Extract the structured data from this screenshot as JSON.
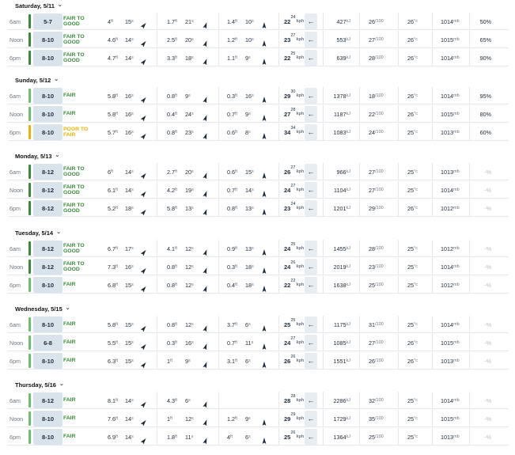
{
  "units": {
    "ft": "ft",
    "s": "s",
    "kph": "kph",
    "kj": "kJ",
    "score": "/100",
    "deg": "°",
    "c": "c",
    "mb": "mb",
    "pct": "%"
  },
  "colors": {
    "good": "#3a8a3a",
    "fair": "#6cc06c",
    "poor": "#e8b400",
    "size_bg": "#d9e3ec"
  },
  "days": [
    {
      "title": "Saturday, 5/11",
      "rows": [
        {
          "time": "6am",
          "size": "5-7",
          "rating": "FAIR TO GOOD",
          "rtype": "good",
          "s1h": "4",
          "s1p": "15",
          "s2h": "1.7",
          "s2p": "21",
          "s3h": "1.4",
          "s3p": "10",
          "wind": "22",
          "gust": "24",
          "kj": "427",
          "wt": "26",
          "temp": "26",
          "pres": "1014",
          "precip": "50"
        },
        {
          "time": "Noon",
          "size": "8-10",
          "rating": "FAIR TO GOOD",
          "rtype": "good",
          "s1h": "4.6",
          "s1p": "14",
          "s2h": "2.5",
          "s2p": "20",
          "s3h": "1.2",
          "s3p": "10",
          "wind": "23",
          "gust": "27",
          "kj": "553",
          "wt": "27",
          "temp": "26",
          "pres": "1015",
          "precip": "65"
        },
        {
          "time": "6pm",
          "size": "8-10",
          "rating": "FAIR TO GOOD",
          "rtype": "good",
          "s1h": "4.7",
          "s1p": "14",
          "s2h": "3.3",
          "s2p": "18",
          "s3h": "1.1",
          "s3p": "9",
          "wind": "22",
          "gust": "25",
          "kj": "639",
          "wt": "28",
          "temp": "26",
          "pres": "1014",
          "precip": "90"
        }
      ]
    },
    {
      "title": "Sunday, 5/12",
      "rows": [
        {
          "time": "6am",
          "size": "8-10",
          "rating": "FAIR",
          "rtype": "fair",
          "s1h": "5.8",
          "s1p": "16",
          "s2h": "0.8",
          "s2p": "9",
          "s3h": "0.3",
          "s3p": "16",
          "wind": "29",
          "gust": "30",
          "kj": "1378",
          "wt": "18",
          "temp": "26",
          "pres": "1014",
          "precip": "95"
        },
        {
          "time": "Noon",
          "size": "8-10",
          "rating": "FAIR",
          "rtype": "fair",
          "s1h": "5.8",
          "s1p": "16",
          "s2h": "0.4",
          "s2p": "24",
          "s3h": "0.7",
          "s3p": "9",
          "wind": "27",
          "gust": "28",
          "kj": "1187",
          "wt": "22",
          "temp": "26",
          "pres": "1015",
          "precip": "80"
        },
        {
          "time": "6pm",
          "size": "8-10",
          "rating": "POOR TO FAIR",
          "rtype": "poor",
          "s1h": "5.7",
          "s1p": "16",
          "s2h": "0.8",
          "s2p": "23",
          "s3h": "0.6",
          "s3p": "8",
          "wind": "34",
          "gust": "34",
          "kj": "1083",
          "wt": "24",
          "temp": "25",
          "pres": "1013",
          "precip": "60"
        }
      ]
    },
    {
      "title": "Monday, 5/13",
      "rows": [
        {
          "time": "6am",
          "size": "8-12",
          "rating": "FAIR TO GOOD",
          "rtype": "good",
          "s1h": "6",
          "s1p": "14",
          "s2h": "2.7",
          "s2p": "20",
          "s3h": "0.6",
          "s3p": "15",
          "wind": "26",
          "gust": "27",
          "kj": "966",
          "wt": "27",
          "temp": "25",
          "pres": "1013",
          "precip": "-"
        },
        {
          "time": "Noon",
          "size": "8-12",
          "rating": "FAIR TO GOOD",
          "rtype": "good",
          "s1h": "6.1",
          "s1p": "14",
          "s2h": "4.2",
          "s2p": "19",
          "s3h": "0.7",
          "s3p": "14",
          "wind": "24",
          "gust": "27",
          "kj": "1104",
          "wt": "27",
          "temp": "25",
          "pres": "1014",
          "precip": "-"
        },
        {
          "time": "6pm",
          "size": "8-12",
          "rating": "FAIR TO GOOD",
          "rtype": "good",
          "s1h": "5.2",
          "s1p": "18",
          "s2h": "5.8",
          "s2p": "13",
          "s3h": "0.8",
          "s3p": "13",
          "wind": "23",
          "gust": "24",
          "kj": "1201",
          "wt": "29",
          "temp": "26",
          "pres": "1012",
          "precip": "-"
        }
      ]
    },
    {
      "title": "Tuesday, 5/14",
      "rows": [
        {
          "time": "6am",
          "size": "8-12",
          "rating": "FAIR TO GOOD",
          "rtype": "good",
          "s1h": "6.7",
          "s1p": "17",
          "s2h": "4.1",
          "s2p": "12",
          "s3h": "0.9",
          "s3p": "13",
          "wind": "24",
          "gust": "25",
          "kj": "1455",
          "wt": "28",
          "temp": "25",
          "pres": "1012",
          "precip": "-"
        },
        {
          "time": "Noon",
          "size": "8-12",
          "rating": "FAIR TO GOOD",
          "rtype": "good",
          "s1h": "7.3",
          "s1p": "16",
          "s2h": "0.8",
          "s2p": "12",
          "s3h": "0.3",
          "s3p": "18",
          "wind": "24",
          "gust": "26",
          "kj": "2019",
          "wt": "23",
          "temp": "25",
          "pres": "1014",
          "precip": "-"
        },
        {
          "time": "6pm",
          "size": "8-10",
          "rating": "FAIR",
          "rtype": "fair",
          "s1h": "6.8",
          "s1p": "15",
          "s2h": "0.8",
          "s2p": "12",
          "s3h": "0.4",
          "s3p": "18",
          "wind": "22",
          "gust": "22",
          "kj": "1638",
          "wt": "25",
          "temp": "25",
          "pres": "1012",
          "precip": "-"
        }
      ]
    },
    {
      "title": "Wednesday, 5/15",
      "rows": [
        {
          "time": "6am",
          "size": "8-10",
          "rating": "FAIR",
          "rtype": "fair",
          "s1h": "5.8",
          "s1p": "15",
          "s2h": "0.8",
          "s2p": "12",
          "s3h": "3.7",
          "s3p": "6",
          "wind": "25",
          "gust": "25",
          "kj": "1175",
          "wt": "31",
          "temp": "25",
          "pres": "1014",
          "precip": "-"
        },
        {
          "time": "Noon",
          "size": "6-8",
          "rating": "FAIR",
          "rtype": "fair",
          "s1h": "5.5",
          "s1p": "15",
          "s2h": "0.3",
          "s2p": "16",
          "s3h": "0.7",
          "s3p": "11",
          "wind": "24",
          "gust": "27",
          "kj": "1085",
          "wt": "27",
          "temp": "26",
          "pres": "1015",
          "precip": "-"
        },
        {
          "time": "6pm",
          "size": "8-10",
          "rating": "FAIR",
          "rtype": "fair",
          "s1h": "6.3",
          "s1p": "15",
          "s2h": "1",
          "s2p": "9",
          "s3h": "3.1",
          "s3p": "6",
          "wind": "26",
          "gust": "26",
          "kj": "1551",
          "wt": "26",
          "temp": "26",
          "pres": "1013",
          "precip": "-"
        }
      ]
    },
    {
      "title": "Thursday, 5/16",
      "rows": [
        {
          "time": "6am",
          "size": "8-12",
          "rating": "FAIR",
          "rtype": "fair",
          "s1h": "8.1",
          "s1p": "14",
          "s2h": "4.3",
          "s2p": "6",
          "s3h": "",
          "s3p": "",
          "wind": "28",
          "gust": "28",
          "kj": "2286",
          "wt": "32",
          "temp": "25",
          "pres": "1014",
          "precip": "-"
        },
        {
          "time": "Noon",
          "size": "8-10",
          "rating": "FAIR",
          "rtype": "fair",
          "s1h": "7.6",
          "s1p": "14",
          "s2h": "1",
          "s2p": "12",
          "s3h": "1.2",
          "s3p": "9",
          "wind": "29",
          "gust": "29",
          "kj": "1729",
          "wt": "35",
          "temp": "25",
          "pres": "1015",
          "precip": "-"
        },
        {
          "time": "6pm",
          "size": "8-10",
          "rating": "FAIR",
          "rtype": "fair",
          "s1h": "6.9",
          "s1p": "14",
          "s2h": "1.8",
          "s2p": "11",
          "s3h": "4",
          "s3p": "6",
          "wind": "25",
          "gust": "26",
          "kj": "1364",
          "wt": "25",
          "temp": "25",
          "pres": "1013",
          "precip": "-"
        }
      ]
    }
  ]
}
